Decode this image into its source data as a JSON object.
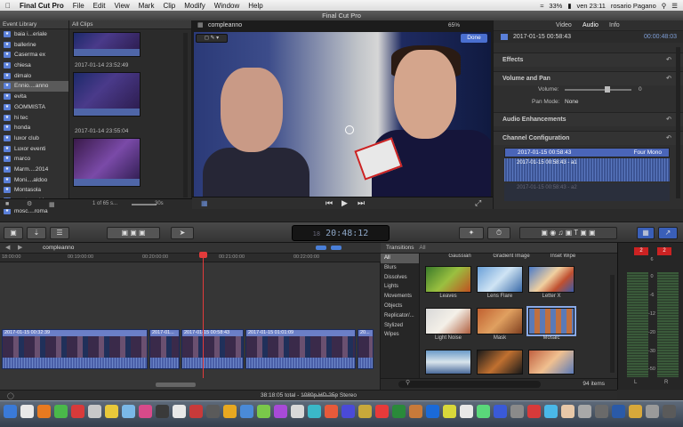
{
  "menubar": {
    "apple": "",
    "app": "Final Cut Pro",
    "items": [
      "File",
      "Edit",
      "View",
      "Mark",
      "Clip",
      "Modify",
      "Window",
      "Help"
    ],
    "battery": "33%",
    "clock": "ven 23:11",
    "user": "rosario Pagano"
  },
  "window": {
    "title": "Final Cut Pro"
  },
  "library": {
    "header": "Event Library",
    "events": [
      "baia i...eriale",
      "ballerine",
      "Caserma ex",
      "chiesa",
      "dimalo",
      "Ennio....anno",
      "evita",
      "GOMMISTA",
      "hi tec",
      "honda",
      "luxor club",
      "Luxor eventi",
      "marco",
      "Marm....2014",
      "Moni....aldoo",
      "Montasola",
      "mont....cchio",
      "mosc....roma"
    ],
    "selected_index": 5
  },
  "browser": {
    "header": "All Clips",
    "clip1_date": "2017-01-14 23:52:49",
    "clip2_date": "2017-01-14 23:55:04",
    "footer_count": "1 of 65 s...",
    "footer_dur": "30s"
  },
  "viewer": {
    "title": "compleanno",
    "zoom": "65%",
    "done_label": "Done"
  },
  "inspector": {
    "tabs": [
      "Video",
      "Audio",
      "Info"
    ],
    "clip_name": "2017-01-15 00:58:43",
    "clip_tc": "00:00:48:03",
    "sections": [
      "Effects",
      "Audio Enhancements",
      "Channel Configuration"
    ],
    "pan_section": "Volume and Pan",
    "volume_label": "Volume:",
    "volume_value": "0",
    "pan_mode_label": "Pan Mode:",
    "pan_mode_value": "None",
    "channel_clip": "2017-01-15 00:58:43",
    "channel_mode": "Four Mono",
    "channel_a1": "2017-01-15 00:58:43 - a1",
    "channel_a2": "2017-01-15 00:58:43 - a2"
  },
  "toolbar": {
    "timecode": "20:48:12",
    "timecode_prefix": "18"
  },
  "timeline": {
    "project": "compleanno",
    "ticks": [
      "18:00:00",
      "00:19:00:00",
      "00:20:00:00",
      "00:21:00:00",
      "00:22:00:00"
    ],
    "clips": [
      {
        "label": "2017-01-15 00:32:39"
      },
      {
        "label": "2017-01..."
      },
      {
        "label": "2017-01-15 00:58:43"
      },
      {
        "label": "2017-01-15 01:01:09"
      },
      {
        "label": "20..."
      }
    ]
  },
  "status": {
    "text": "38:18:05 total - 1080p HD 25p Stereo"
  },
  "transitions": {
    "header": "Transitions",
    "filter": "All",
    "categories": [
      "All",
      "Blurs",
      "Dissolves",
      "Lights",
      "Movements",
      "Objects",
      "Replicator/...",
      "Stylized",
      "Wipes"
    ],
    "top_labels": [
      "Gaussian",
      "Gradient Image",
      "Inset Wipe"
    ],
    "row1": [
      "Leaves",
      "Lens Flare",
      "Letter X"
    ],
    "row2": [
      "Light Noise",
      "Mask",
      "Mosaic"
    ],
    "count": "94 items"
  },
  "meters": {
    "peak_left": "2",
    "peak_right": "2",
    "scale": [
      "6",
      "0",
      "-6",
      "-12",
      "-20",
      "-30",
      "-50"
    ],
    "channels": [
      "L",
      "R"
    ]
  }
}
